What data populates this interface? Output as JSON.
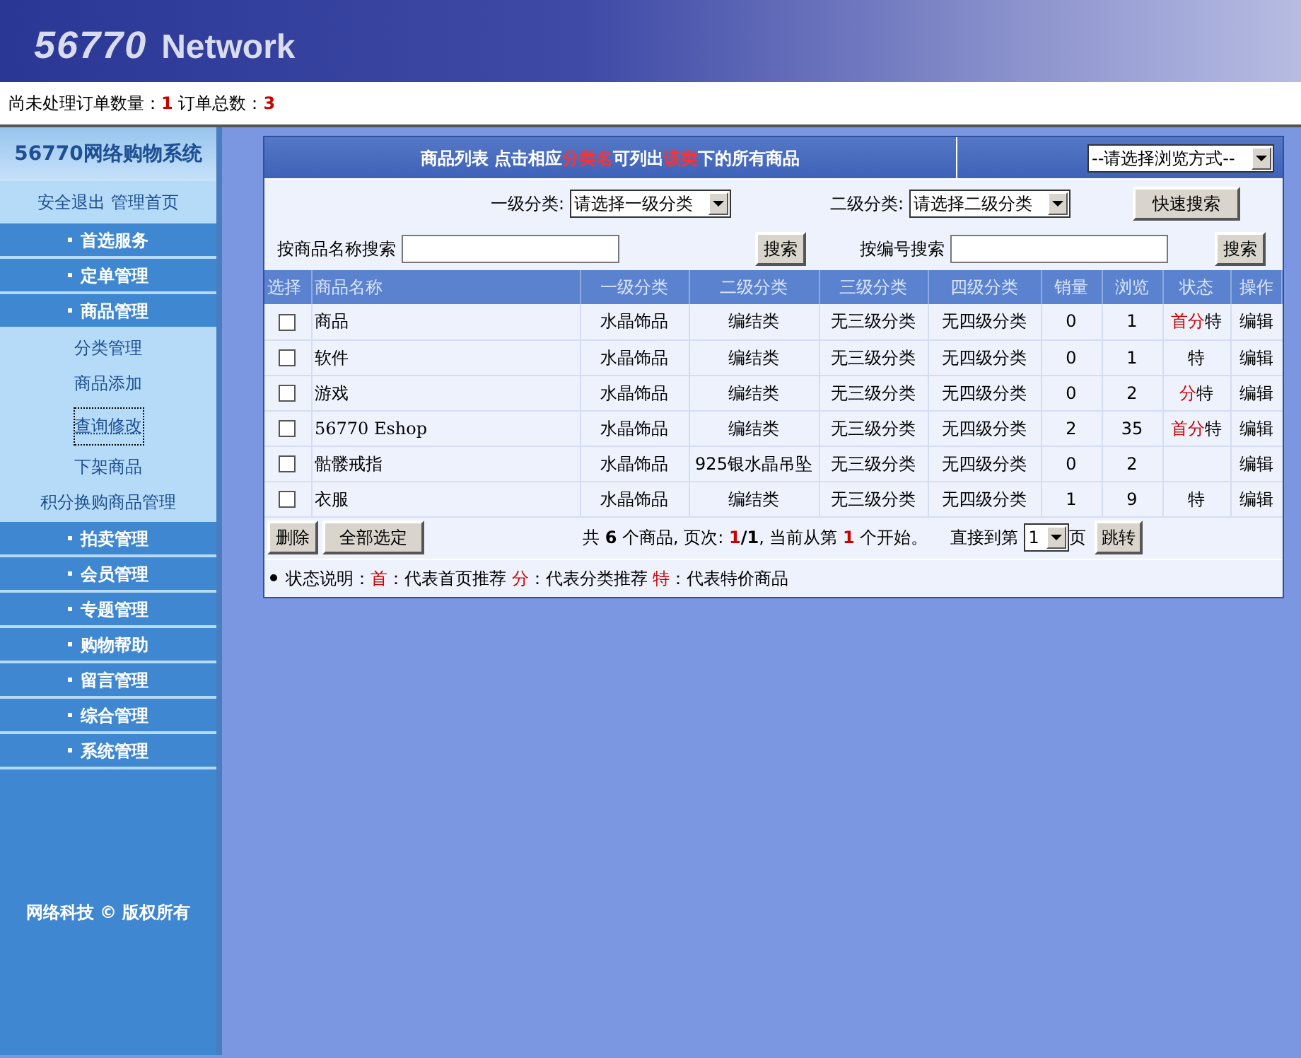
{
  "banner": {
    "logo_number": "56770",
    "logo_word": "Network"
  },
  "order_bar": [
    {
      "text": "尚未处理订单数量：",
      "kind": "plain"
    },
    {
      "text": "1",
      "kind": "red"
    },
    {
      "text": " 订单总数：",
      "kind": "plain"
    },
    {
      "text": "3",
      "kind": "red"
    }
  ],
  "sidebar": {
    "title": "56770网络购物系统",
    "links": [
      "安全退出",
      "管理首页"
    ],
    "menu": [
      {
        "label": "首选服务"
      },
      {
        "label": "定单管理"
      },
      {
        "label": "商品管理",
        "children": [
          {
            "label": "分类管理",
            "selected": false
          },
          {
            "label": "商品添加",
            "selected": false
          },
          {
            "label": "查询修改",
            "selected": true
          },
          {
            "label": "下架商品",
            "selected": false
          },
          {
            "label": "积分换购商品管理",
            "selected": false
          }
        ]
      },
      {
        "label": "拍卖管理"
      },
      {
        "label": "会员管理"
      },
      {
        "label": "专题管理"
      },
      {
        "label": "购物帮助"
      },
      {
        "label": "留言管理"
      },
      {
        "label": "综合管理"
      },
      {
        "label": "系统管理"
      }
    ],
    "copyright": "网络科技 © 版权所有"
  },
  "panel": {
    "title": [
      {
        "text": "商品列表 点击相应",
        "kind": "plain"
      },
      {
        "text": "分类名",
        "kind": "red"
      },
      {
        "text": "可列出",
        "kind": "plain"
      },
      {
        "text": "该类",
        "kind": "red"
      },
      {
        "text": "下的所有商品",
        "kind": "plain"
      }
    ],
    "browse_select": "--请选择浏览方式--",
    "level1_label": "一级分类:",
    "level1_select": "请选择一级分类",
    "level2_label": "二级分类:",
    "level2_select": "请选择二级分类",
    "quick_search": "快速搜索",
    "name_search_label": "按商品名称搜索",
    "name_search_button": "搜索",
    "code_search_label": "按编号搜索",
    "code_search_button": "搜索",
    "columns": [
      "选择",
      "商品名称",
      "一级分类",
      "二级分类",
      "三级分类",
      "四级分类",
      "销量",
      "浏览",
      "状态",
      "操作"
    ],
    "rows": [
      {
        "checked": false,
        "name": "商品",
        "cat1": "水晶饰品",
        "cat2": "编结类",
        "cat3": "无三级分类",
        "cat4": "无四级分类",
        "sales": "0",
        "views": "1",
        "status": [
          {
            "text": "首",
            "kind": "red"
          },
          {
            "text": "分",
            "kind": "red"
          },
          {
            "text": "特",
            "kind": "plain"
          }
        ],
        "action": "编辑"
      },
      {
        "checked": false,
        "name": "软件",
        "cat1": "水晶饰品",
        "cat2": "编结类",
        "cat3": "无三级分类",
        "cat4": "无四级分类",
        "sales": "0",
        "views": "1",
        "status": [
          {
            "text": "特",
            "kind": "plain"
          }
        ],
        "action": "编辑"
      },
      {
        "checked": false,
        "name": "游戏",
        "cat1": "水晶饰品",
        "cat2": "编结类",
        "cat3": "无三级分类",
        "cat4": "无四级分类",
        "sales": "0",
        "views": "2",
        "status": [
          {
            "text": "分",
            "kind": "red"
          },
          {
            "text": "特",
            "kind": "plain"
          }
        ],
        "action": "编辑"
      },
      {
        "checked": false,
        "name": "56770 Eshop",
        "cat1": "水晶饰品",
        "cat2": "编结类",
        "cat3": "无三级分类",
        "cat4": "无四级分类",
        "sales": "2",
        "views": "35",
        "status": [
          {
            "text": "首",
            "kind": "red"
          },
          {
            "text": "分",
            "kind": "red"
          },
          {
            "text": "特",
            "kind": "plain"
          }
        ],
        "action": "编辑"
      },
      {
        "checked": false,
        "name": "骷髅戒指",
        "cat1": "水晶饰品",
        "cat2": "925银水晶吊坠",
        "cat3": "无三级分类",
        "cat4": "无四级分类",
        "sales": "0",
        "views": "2",
        "action": "编辑"
      },
      {
        "checked": false,
        "name": "衣服",
        "cat1": "水晶饰品",
        "cat2": "编结类",
        "cat3": "无三级分类",
        "cat4": "无四级分类",
        "sales": "1",
        "views": "9",
        "status": [
          {
            "text": "特",
            "kind": "plain"
          }
        ],
        "action": "编辑"
      }
    ],
    "delete_button": "删除",
    "select_all_button": "全部选定",
    "pager": [
      {
        "text": "共 ",
        "kind": "plain"
      },
      {
        "text": "6",
        "kind": "bold"
      },
      {
        "text": " 个商品, 页次: ",
        "kind": "plain"
      },
      {
        "text": "1",
        "kind": "red"
      },
      {
        "text": "/1",
        "kind": "bold"
      },
      {
        "text": ", 当前从第 ",
        "kind": "plain"
      },
      {
        "text": "1",
        "kind": "red"
      },
      {
        "text": " 个开始。",
        "kind": "plain"
      }
    ],
    "goto_label": "直接到第",
    "page_select": "1",
    "page_unit": "页",
    "goto_button": "跳转",
    "legend": [
      {
        "text": "状态说明：",
        "kind": "plain"
      },
      {
        "text": "首",
        "kind": "red"
      },
      {
        "text": "：代表首页推荐 ",
        "kind": "plain"
      },
      {
        "text": "分",
        "kind": "red"
      },
      {
        "text": "：代表分类推荐 ",
        "kind": "plain"
      },
      {
        "text": "特",
        "kind": "red"
      },
      {
        "text": "：代表特价商品",
        "kind": "plain"
      }
    ]
  }
}
